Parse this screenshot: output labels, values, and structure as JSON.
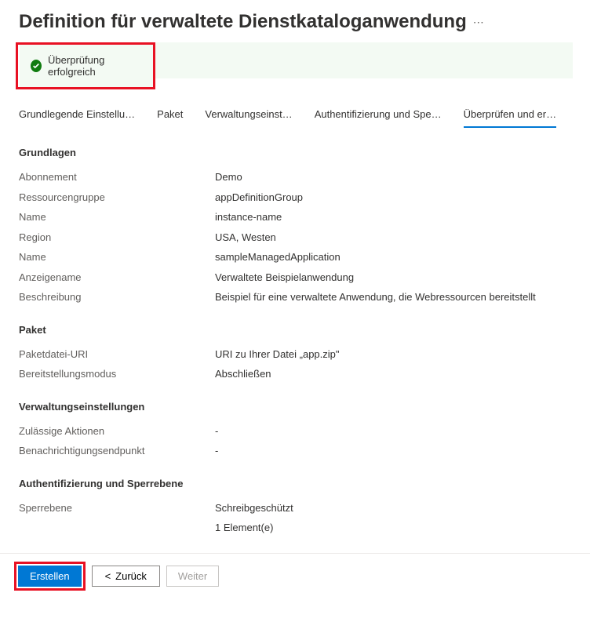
{
  "header": {
    "title": "Definition für verwaltete Dienstkataloganwendung"
  },
  "validation": {
    "message": "Überprüfung erfolgreich"
  },
  "tabs": [
    {
      "label": "Grundlegende Einstellu…"
    },
    {
      "label": "Paket"
    },
    {
      "label": "Verwaltungseinst…"
    },
    {
      "label": "Authentifizierung und Spe…"
    },
    {
      "label": "Überprüfen und er…"
    }
  ],
  "sections": {
    "basics": {
      "title": "Grundlagen",
      "rows": [
        {
          "label": "Abonnement",
          "value": "Demo"
        },
        {
          "label": "Ressourcengruppe",
          "value": "appDefinitionGroup"
        },
        {
          "label": "Name",
          "value": "instance-name"
        },
        {
          "label": "Region",
          "value": "USA, Westen"
        },
        {
          "label": "Name",
          "value": "sampleManagedApplication"
        },
        {
          "label": "Anzeigename",
          "value": "Verwaltete Beispielanwendung"
        },
        {
          "label": "Beschreibung",
          "value": "Beispiel für eine verwaltete Anwendung, die Webressourcen bereitstellt"
        }
      ]
    },
    "package": {
      "title": "Paket",
      "rows": [
        {
          "label": "Paketdatei-URI",
          "value": " URI zu Ihrer Datei „app.zip\""
        },
        {
          "label": "Bereitstellungsmodus",
          "value": "Abschließen"
        }
      ]
    },
    "management": {
      "title": "Verwaltungseinstellungen",
      "rows": [
        {
          "label": "Zulässige Aktionen",
          "value": "-"
        },
        {
          "label": "Benachrichtigungsendpunkt",
          "value": "-"
        }
      ]
    },
    "auth": {
      "title": "Authentifizierung und Sperrebene",
      "rows": [
        {
          "label": "Sperrebene",
          "value": "Schreibgeschützt"
        },
        {
          "label": "",
          "value": "1 Element(e)"
        }
      ]
    }
  },
  "footer": {
    "create": "Erstellen",
    "back": "Zurück",
    "next": "Weiter"
  }
}
